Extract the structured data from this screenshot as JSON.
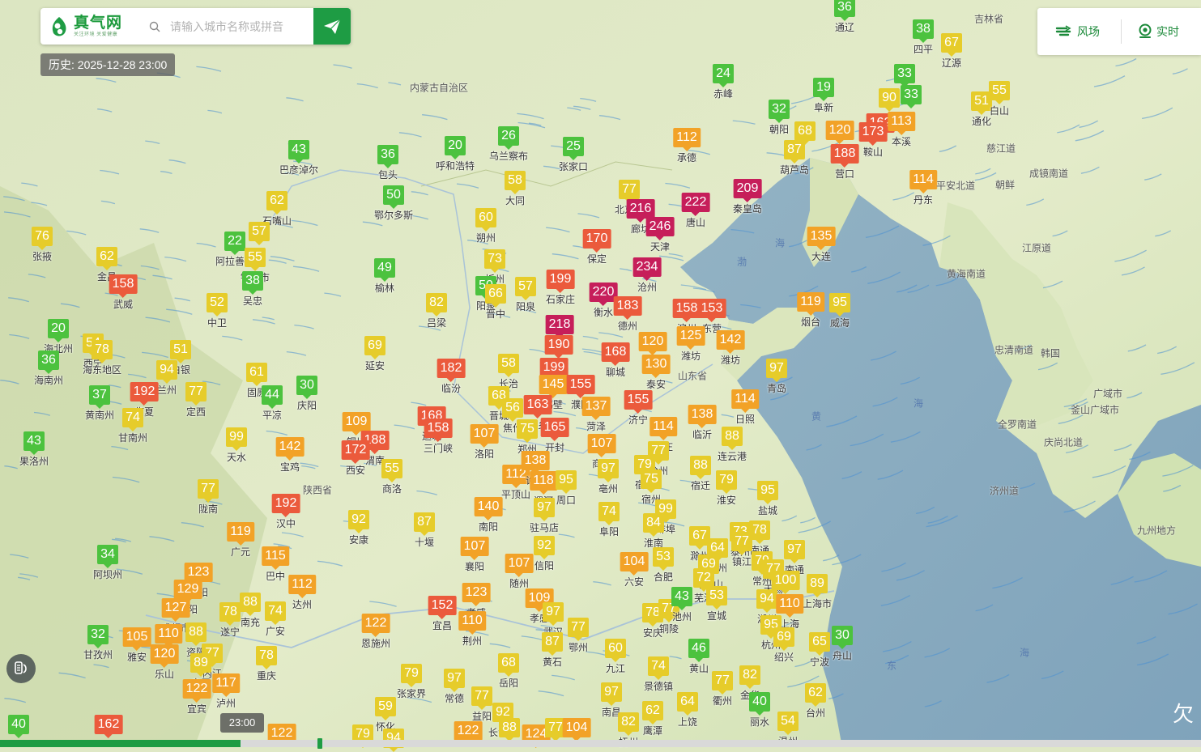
{
  "brand": {
    "name": "真气网",
    "slogan": "关注环境  关爱健康"
  },
  "search": {
    "placeholder": "请输入城市名称或拼音",
    "icon": "search-icon",
    "submit_icon": "paper-plane-icon"
  },
  "history": {
    "label": "历史: 2025-12-28 23:00"
  },
  "controls": {
    "wind_label": "风场",
    "wind_icon": "wind-icon",
    "realtime_label": "实时",
    "realtime_icon": "location-pin-icon"
  },
  "timeline": {
    "time_label": "23:00",
    "progress": 0.2
  },
  "legend_colors": {
    "good": "#4cc23e",
    "moderate": "#e6cc2a",
    "light": "#f2a227",
    "moderate_poll": "#eb5a3c",
    "heavy": "#c61e5a"
  },
  "regions": [
    "内蒙古自治区",
    "陕西省",
    "山东省",
    "吉林省",
    "朝鲜",
    "韩国",
    "江原道",
    "黄海南道",
    "忠清南道",
    "全罗南道",
    "广域市",
    "釜山广域市",
    "庆尚北道",
    "平安北道",
    "成镜南道",
    "济州道",
    "九州地方",
    "慈江道"
  ],
  "seas": [
    "渤",
    "海",
    "黄",
    "海",
    "东",
    "海"
  ],
  "stations": [
    {
      "aqi": 36,
      "city": "通辽"
    },
    {
      "aqi": 38,
      "city": "四平"
    },
    {
      "aqi": 67,
      "city": "辽源"
    },
    {
      "aqi": 24,
      "city": "赤峰"
    },
    {
      "aqi": 33,
      "city": ""
    },
    {
      "aqi": 90,
      "city": ""
    },
    {
      "aqi": 33,
      "city": ""
    },
    {
      "aqi": 19,
      "city": "阜新"
    },
    {
      "aqi": 32,
      "city": "朝阳"
    },
    {
      "aqi": 68,
      "city": ""
    },
    {
      "aqi": 120,
      "city": ""
    },
    {
      "aqi": 162,
      "city": ""
    },
    {
      "aqi": 173,
      "city": "鞍山"
    },
    {
      "aqi": 113,
      "city": "本溪"
    },
    {
      "aqi": 87,
      "city": "葫芦岛"
    },
    {
      "aqi": 188,
      "city": "营口"
    },
    {
      "aqi": 51,
      "city": "通化"
    },
    {
      "aqi": 55,
      "city": "白山"
    },
    {
      "aqi": 112,
      "city": "承德"
    },
    {
      "aqi": 114,
      "city": "丹东"
    },
    {
      "aqi": 209,
      "city": "秦皇岛"
    },
    {
      "aqi": 135,
      "city": "大连"
    },
    {
      "aqi": 43,
      "city": "巴彦淖尔"
    },
    {
      "aqi": 36,
      "city": "包头"
    },
    {
      "aqi": 20,
      "city": "呼和浩特"
    },
    {
      "aqi": 26,
      "city": "乌兰察布"
    },
    {
      "aqi": 25,
      "city": "张家口"
    },
    {
      "aqi": 77,
      "city": "北京市"
    },
    {
      "aqi": 216,
      "city": "廊坊"
    },
    {
      "aqi": 222,
      "city": "唐山"
    },
    {
      "aqi": 246,
      "city": "天津"
    },
    {
      "aqi": 62,
      "city": "石嘴山"
    },
    {
      "aqi": 50,
      "city": "鄂尔多斯"
    },
    {
      "aqi": 58,
      "city": "大同"
    },
    {
      "aqi": 60,
      "city": "朔州"
    },
    {
      "aqi": 170,
      "city": "保定"
    },
    {
      "aqi": 234,
      "city": "沧州"
    },
    {
      "aqi": 76,
      "city": "张掖"
    },
    {
      "aqi": 57,
      "city": ""
    },
    {
      "aqi": 22,
      "city": "阿拉善盟"
    },
    {
      "aqi": 55,
      "city": "银川市"
    },
    {
      "aqi": 62,
      "city": "金昌"
    },
    {
      "aqi": 158,
      "city": "武威"
    },
    {
      "aqi": 38,
      "city": "吴忠"
    },
    {
      "aqi": 49,
      "city": "榆林"
    },
    {
      "aqi": 73,
      "city": "忻州"
    },
    {
      "aqi": 50,
      "city": "阳泉"
    },
    {
      "aqi": 57,
      "city": "阳泉"
    },
    {
      "aqi": 199,
      "city": "石家庄"
    },
    {
      "aqi": 66,
      "city": "晋中"
    },
    {
      "aqi": 220,
      "city": "衡水"
    },
    {
      "aqi": 183,
      "city": "德州"
    },
    {
      "aqi": 158,
      "city": "滨州"
    },
    {
      "aqi": 153,
      "city": "东营"
    },
    {
      "aqi": 119,
      "city": "烟台"
    },
    {
      "aqi": 95,
      "city": "威海"
    },
    {
      "aqi": 52,
      "city": "中卫"
    },
    {
      "aqi": 82,
      "city": "吕梁"
    },
    {
      "aqi": 218,
      "city": "邢台"
    },
    {
      "aqi": 20,
      "city": "海北州"
    },
    {
      "aqi": 36,
      "city": "海南州"
    },
    {
      "aqi": 54,
      "city": "西宁"
    },
    {
      "aqi": 78,
      "city": "海东地区"
    },
    {
      "aqi": 51,
      "city": "白银"
    },
    {
      "aqi": 94,
      "city": "兰州"
    },
    {
      "aqi": 61,
      "city": "固原"
    },
    {
      "aqi": 69,
      "city": "延安"
    },
    {
      "aqi": 190,
      "city": "邯郸"
    },
    {
      "aqi": 168,
      "city": "聊城"
    },
    {
      "aqi": 120,
      "city": "淄博"
    },
    {
      "aqi": 125,
      "city": "潍坊"
    },
    {
      "aqi": 142,
      "city": "潍坊"
    },
    {
      "aqi": 130,
      "city": "泰安"
    },
    {
      "aqi": 182,
      "city": "临汾"
    },
    {
      "aqi": 58,
      "city": "长治"
    },
    {
      "aqi": 199,
      "city": "安阳"
    },
    {
      "aqi": 145,
      "city": "鹤壁"
    },
    {
      "aqi": 155,
      "city": "濮阳"
    },
    {
      "aqi": 97,
      "city": "青岛"
    },
    {
      "aqi": 37,
      "city": "黄南州"
    },
    {
      "aqi": 192,
      "city": "临夏"
    },
    {
      "aqi": 77,
      "city": "定西"
    },
    {
      "aqi": 44,
      "city": "平凉"
    },
    {
      "aqi": 30,
      "city": "庆阳"
    },
    {
      "aqi": 74,
      "city": "甘南州"
    },
    {
      "aqi": 68,
      "city": "晋城"
    },
    {
      "aqi": 56,
      "city": "焦作"
    },
    {
      "aqi": 163,
      "city": "新乡"
    },
    {
      "aqi": 137,
      "city": "菏泽"
    },
    {
      "aqi": 155,
      "city": "济宁"
    },
    {
      "aqi": 114,
      "city": "日照"
    },
    {
      "aqi": 168,
      "city": "运城"
    },
    {
      "aqi": 158,
      "city": "三门峡"
    },
    {
      "aqi": 109,
      "city": "铜川"
    },
    {
      "aqi": 188,
      "city": "渭南"
    },
    {
      "aqi": 172,
      "city": "西安"
    },
    {
      "aqi": 107,
      "city": "洛阳"
    },
    {
      "aqi": 75,
      "city": "郑州"
    },
    {
      "aqi": 165,
      "city": "开封"
    },
    {
      "aqi": 114,
      "city": "枣庄"
    },
    {
      "aqi": 138,
      "city": "临沂"
    },
    {
      "aqi": 43,
      "city": "果洛州"
    },
    {
      "aqi": 99,
      "city": "天水"
    },
    {
      "aqi": 142,
      "city": "宝鸡"
    },
    {
      "aqi": 55,
      "city": "商洛"
    },
    {
      "aqi": 107,
      "city": "商丘"
    },
    {
      "aqi": 77,
      "city": "徐州"
    },
    {
      "aqi": 88,
      "city": "连云港"
    },
    {
      "aqi": 112,
      "city": "平顶山"
    },
    {
      "aqi": 138,
      "city": "许昌"
    },
    {
      "aqi": 118,
      "city": "漯河"
    },
    {
      "aqi": 95,
      "city": "周口"
    },
    {
      "aqi": 97,
      "city": "亳州"
    },
    {
      "aqi": 79,
      "city": "宿州"
    },
    {
      "aqi": 75,
      "city": "宿州"
    },
    {
      "aqi": 88,
      "city": "宿迁"
    },
    {
      "aqi": 79,
      "city": "淮安"
    },
    {
      "aqi": 77,
      "city": "陇南"
    },
    {
      "aqi": 192,
      "city": "汉中"
    },
    {
      "aqi": 92,
      "city": "安康"
    },
    {
      "aqi": 87,
      "city": "十堰"
    },
    {
      "aqi": 140,
      "city": "南阳"
    },
    {
      "aqi": 97,
      "city": "驻马店"
    },
    {
      "aqi": 74,
      "city": "阜阳"
    },
    {
      "aqi": 99,
      "city": "蚌埠"
    },
    {
      "aqi": 95,
      "city": "盐城"
    },
    {
      "aqi": 84,
      "city": "淮南"
    },
    {
      "aqi": 119,
      "city": "广元"
    },
    {
      "aqi": 115,
      "city": "巴中"
    },
    {
      "aqi": 107,
      "city": "襄阳"
    },
    {
      "aqi": 92,
      "city": "信阳"
    },
    {
      "aqi": 107,
      "city": "随州"
    },
    {
      "aqi": 67,
      "city": "滁州"
    },
    {
      "aqi": 64,
      "city": "扬州"
    },
    {
      "aqi": 73,
      "city": "泰州"
    },
    {
      "aqi": 78,
      "city": "南通"
    },
    {
      "aqi": 77,
      "city": "镇江"
    },
    {
      "aqi": 97,
      "city": "南通"
    },
    {
      "aqi": 34,
      "city": "阿坝州"
    },
    {
      "aqi": 123,
      "city": "绵阳"
    },
    {
      "aqi": 112,
      "city": "达州"
    },
    {
      "aqi": 104,
      "city": "六安"
    },
    {
      "aqi": 53,
      "city": "合肥"
    },
    {
      "aqi": 69,
      "city": "马鞍山"
    },
    {
      "aqi": 72,
      "city": "芜湖"
    },
    {
      "aqi": 79,
      "city": "常州"
    },
    {
      "aqi": 77,
      "city": "无锡"
    },
    {
      "aqi": 100,
      "city": "苏州"
    },
    {
      "aqi": 89,
      "city": "上海市"
    },
    {
      "aqi": 129,
      "city": "德阳"
    },
    {
      "aqi": 123,
      "city": "孝感"
    },
    {
      "aqi": 109,
      "city": "孝感"
    },
    {
      "aqi": 152,
      "city": "宜昌"
    },
    {
      "aqi": 110,
      "city": "荆州"
    },
    {
      "aqi": 94,
      "city": "湖州"
    },
    {
      "aqi": 110,
      "city": "上海"
    },
    {
      "aqi": 127,
      "city": "成都市"
    },
    {
      "aqi": 78,
      "city": "遂宁"
    },
    {
      "aqi": 88,
      "city": "南充"
    },
    {
      "aqi": 74,
      "city": "广安"
    },
    {
      "aqi": 122,
      "city": "恩施州"
    },
    {
      "aqi": 97,
      "city": "武汉"
    },
    {
      "aqi": 77,
      "city": "鄂州"
    },
    {
      "aqi": 78,
      "city": "安庆"
    },
    {
      "aqi": 77,
      "city": "铜陵"
    },
    {
      "aqi": 43,
      "city": "池州"
    },
    {
      "aqi": 53,
      "city": "宣城"
    },
    {
      "aqi": 95,
      "city": "杭州"
    },
    {
      "aqi": 69,
      "city": "绍兴"
    },
    {
      "aqi": 65,
      "city": "宁波"
    },
    {
      "aqi": 30,
      "city": "舟山"
    },
    {
      "aqi": 32,
      "city": "甘孜州"
    },
    {
      "aqi": 105,
      "city": "雅安"
    },
    {
      "aqi": 110,
      "city": "眉山"
    },
    {
      "aqi": 88,
      "city": "资阳"
    },
    {
      "aqi": 87,
      "city": "黄石"
    },
    {
      "aqi": 60,
      "city": "九江"
    },
    {
      "aqi": 46,
      "city": "黄山"
    },
    {
      "aqi": 120,
      "city": "乐山"
    },
    {
      "aqi": 77,
      "city": "内江"
    },
    {
      "aqi": 89,
      "city": "自贡"
    },
    {
      "aqi": 78,
      "city": "重庆"
    },
    {
      "aqi": 68,
      "city": "岳阳"
    },
    {
      "aqi": 74,
      "city": "景德镇"
    },
    {
      "aqi": 82,
      "city": "金华"
    },
    {
      "aqi": 77,
      "city": "衢州"
    },
    {
      "aqi": 122,
      "city": "宜宾"
    },
    {
      "aqi": 117,
      "city": "泸州"
    },
    {
      "aqi": 79,
      "city": "张家界"
    },
    {
      "aqi": 97,
      "city": "常德"
    },
    {
      "aqi": 77,
      "city": "益阳"
    },
    {
      "aqi": 97,
      "city": "南昌"
    },
    {
      "aqi": 64,
      "city": "上饶"
    },
    {
      "aqi": 62,
      "city": "台州"
    },
    {
      "aqi": 40,
      "city": "丽水"
    },
    {
      "aqi": 54,
      "city": "温州"
    },
    {
      "aqi": 59,
      "city": "怀化"
    },
    {
      "aqi": 92,
      "city": "长沙市"
    },
    {
      "aqi": 82,
      "city": "抚州"
    },
    {
      "aqi": 62,
      "city": "鹰潭"
    },
    {
      "aqi": 40,
      "city": ""
    },
    {
      "aqi": 162,
      "city": ""
    },
    {
      "aqi": 122,
      "city": ""
    },
    {
      "aqi": 79,
      "city": ""
    },
    {
      "aqi": 94,
      "city": ""
    },
    {
      "aqi": 122,
      "city": ""
    },
    {
      "aqi": 88,
      "city": ""
    },
    {
      "aqi": 124,
      "city": ""
    },
    {
      "aqi": 77,
      "city": ""
    },
    {
      "aqi": 104,
      "city": ""
    }
  ]
}
